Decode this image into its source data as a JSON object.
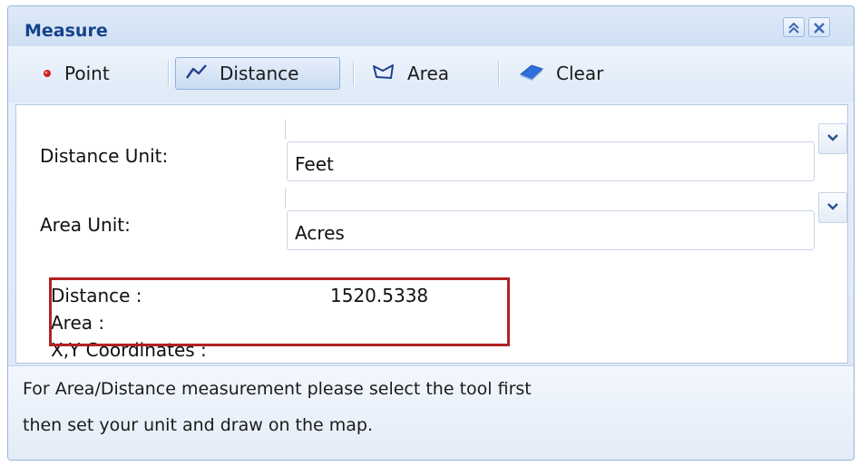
{
  "window": {
    "title": "Measure",
    "collapse_icon": "double-chevron-up",
    "close_icon": "close-x"
  },
  "toolbar": {
    "point_label": "Point",
    "distance_label": "Distance",
    "area_label": "Area",
    "clear_label": "Clear",
    "active_tool": "Distance"
  },
  "form": {
    "distance_unit_label": "Distance Unit:",
    "distance_unit_value": "Feet",
    "area_unit_label": "Area Unit:",
    "area_unit_value": "Acres"
  },
  "results": {
    "distance_label": "Distance :",
    "distance_value": "1520.5338",
    "area_label": "Area :",
    "area_value": "",
    "coords_label": "X,Y Coordinates :",
    "coords_value": ""
  },
  "info": {
    "line1": "For Area/Distance measurement please select the tool first",
    "line2": "then set your unit and draw on the map."
  },
  "colors": {
    "title_text": "#15428b",
    "highlight_border": "#b22222",
    "panel_border": "#9db4d6"
  }
}
